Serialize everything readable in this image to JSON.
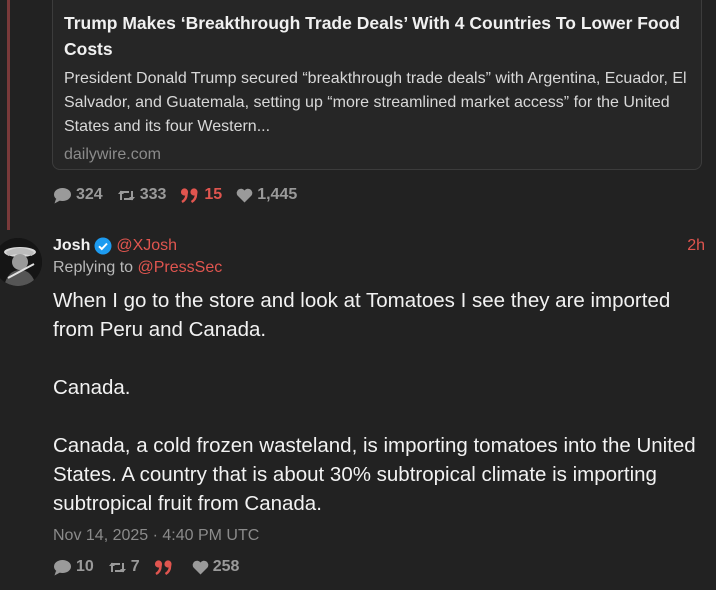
{
  "quoted_card": {
    "title": "Trump Makes ‘Breakthrough Trade Deals’ With 4 Countries To Lower Food Costs",
    "description": "President Donald Trump secured “breakthrough trade deals” with Argentina, Ecuador, El Salvador, and Guatemala, setting up “more streamlined market access” for the United States and its four Western...",
    "domain": "dailywire.com"
  },
  "parent_actions": {
    "replies": "324",
    "reposts": "333",
    "quotes": "15",
    "likes": "1,445"
  },
  "post": {
    "author_name": "Josh",
    "handle": "@XJosh",
    "time_ago": "2h",
    "replying_prefix": "Replying to",
    "replying_to": "@PressSec",
    "paragraphs": [
      "When I go to the store and look at Tomatoes I see they are imported from Peru and Canada.",
      "Canada.",
      "Canada, a cold frozen wasteland, is importing tomatoes into the United States. A country that is about 30% subtropical climate is importing subtropical fruit from Canada."
    ],
    "timestamp": "Nov 14, 2025 · 4:40 PM UTC",
    "actions": {
      "replies": "10",
      "reposts": "7",
      "quotes": "",
      "likes": "258"
    }
  },
  "colors": {
    "background": "#222222",
    "accent": "#e0554f",
    "muted": "#8b8b8b",
    "verified": "#1d9bf0"
  },
  "icons": [
    "reply-icon",
    "repost-icon",
    "quote-icon",
    "heart-icon",
    "verified-badge-icon"
  ]
}
